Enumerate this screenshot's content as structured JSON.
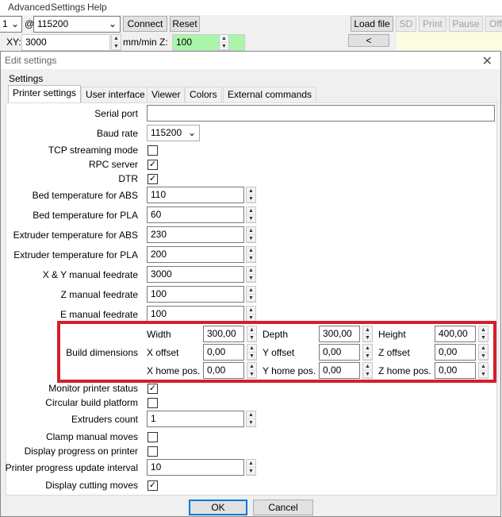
{
  "menu": [
    "Advanced",
    "Settings",
    "Help"
  ],
  "toolbar": {
    "port": "1",
    "at": "@",
    "baud": "115200",
    "connect": "Connect",
    "reset": "Reset",
    "load_file": "Load file",
    "sd": "SD",
    "print": "Print",
    "pause": "Pause",
    "off": "Off",
    "xy_label": "XY:",
    "xy_value": "3000",
    "z_label": "mm/min Z:",
    "z_value": "100",
    "back": "<"
  },
  "dialog": {
    "title": "Edit settings",
    "group": "Settings",
    "tabs": [
      "Printer settings",
      "User interface",
      "Viewer",
      "Colors",
      "External commands"
    ],
    "fields": {
      "serial_port": {
        "label": "Serial port",
        "value": ""
      },
      "baud_rate": {
        "label": "Baud rate",
        "value": "115200"
      },
      "tcp": {
        "label": "TCP streaming mode",
        "checked": false
      },
      "rpc": {
        "label": "RPC server",
        "checked": true
      },
      "dtr": {
        "label": "DTR",
        "checked": true
      },
      "bed_abs": {
        "label": "Bed temperature for ABS",
        "value": "110"
      },
      "bed_pla": {
        "label": "Bed temperature for PLA",
        "value": "60"
      },
      "ext_abs": {
        "label": "Extruder temperature for ABS",
        "value": "230"
      },
      "ext_pla": {
        "label": "Extruder temperature for PLA",
        "value": "200"
      },
      "xy_feed": {
        "label": "X & Y manual feedrate",
        "value": "3000"
      },
      "z_feed": {
        "label": "Z manual feedrate",
        "value": "100"
      },
      "e_feed": {
        "label": "E manual feedrate",
        "value": "100"
      },
      "monitor": {
        "label": "Monitor printer status",
        "checked": true
      },
      "circular": {
        "label": "Circular build platform",
        "checked": false
      },
      "extruders": {
        "label": "Extruders count",
        "value": "1"
      },
      "clamp": {
        "label": "Clamp manual moves",
        "checked": false
      },
      "display_progress": {
        "label": "Display progress on printer",
        "checked": false
      },
      "interval": {
        "label": "Printer progress update interval",
        "value": "10"
      },
      "cutting": {
        "label": "Display cutting moves",
        "checked": true
      }
    },
    "build": {
      "label": "Build dimensions",
      "highlight_color": "#d41f2b",
      "width": {
        "label": "Width",
        "value": "300,00"
      },
      "depth": {
        "label": "Depth",
        "value": "300,00"
      },
      "height": {
        "label": "Height",
        "value": "400,00"
      },
      "x_offset": {
        "label": "X offset",
        "value": "0,00"
      },
      "y_offset": {
        "label": "Y offset",
        "value": "0,00"
      },
      "z_offset": {
        "label": "Z offset",
        "value": "0,00"
      },
      "x_home": {
        "label": "X home pos.",
        "value": "0,00"
      },
      "y_home": {
        "label": "Y home pos.",
        "value": "0,00"
      },
      "z_home": {
        "label": "Z home pos.",
        "value": "0,00"
      }
    },
    "ok": "OK",
    "cancel": "Cancel"
  }
}
